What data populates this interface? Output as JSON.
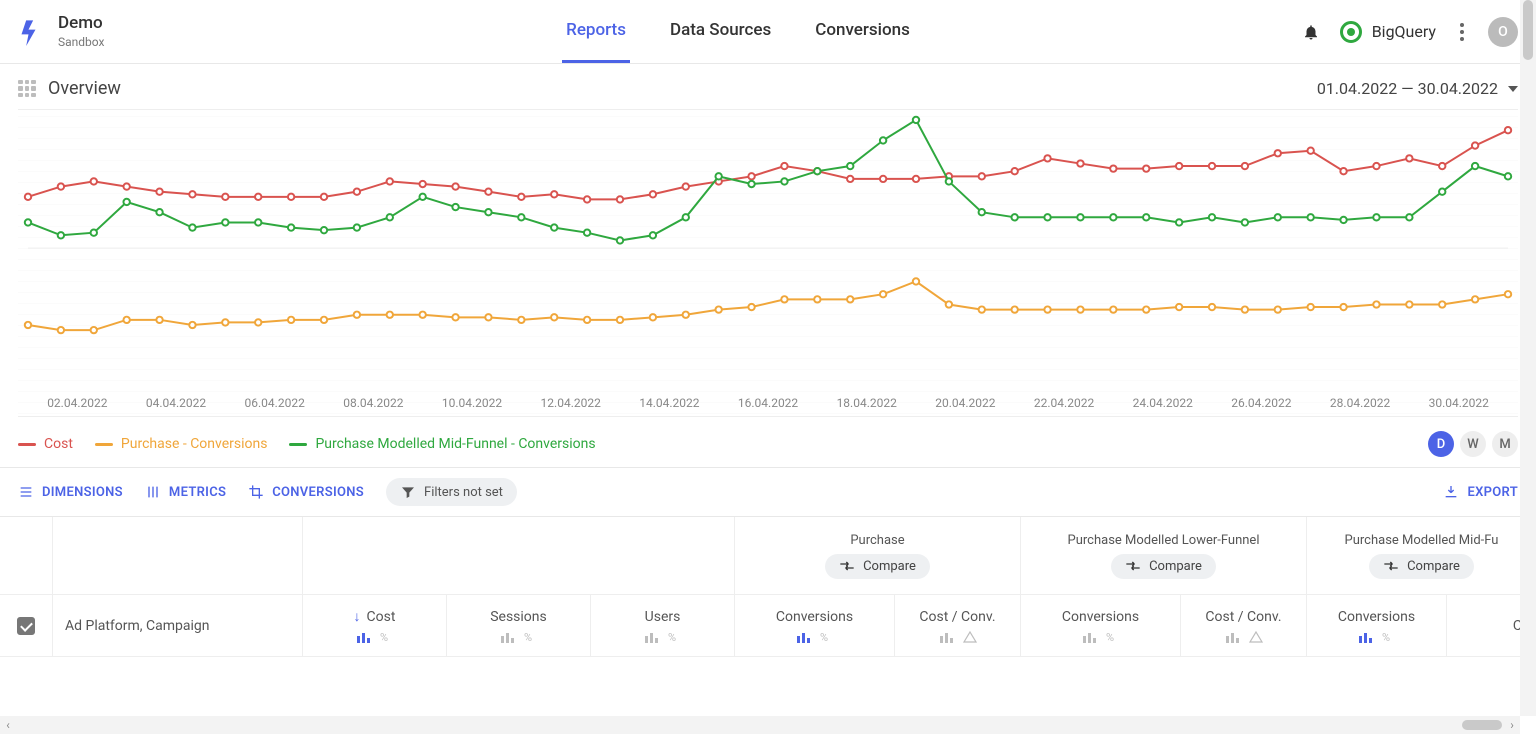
{
  "header": {
    "title": "Demo",
    "subtitle": "Sandbox",
    "nav": {
      "reports": "Reports",
      "data_sources": "Data Sources",
      "conversions": "Conversions",
      "active": "reports"
    },
    "db_label": "BigQuery",
    "avatar_initial": "O"
  },
  "subheader": {
    "page_title": "Overview",
    "date_range": "01.04.2022 — 30.04.2022"
  },
  "legend": {
    "items": [
      {
        "label": "Cost",
        "color": "#d9534f"
      },
      {
        "label": "Purchase - Conversions",
        "color": "#f0a63a"
      },
      {
        "label": "Purchase Modelled Mid-Funnel - Conversions",
        "color": "#2fa83f"
      }
    ],
    "granularity": {
      "options": [
        "D",
        "W",
        "M"
      ],
      "active": "D"
    }
  },
  "toolbar": {
    "dimensions": "DIMENSIONS",
    "metrics": "METRICS",
    "conversions": "CONVERSIONS",
    "filters": "Filters not set",
    "export": "EXPORT"
  },
  "table": {
    "groups": {
      "purchase": "Purchase",
      "lower_funnel": "Purchase Modelled Lower-Funnel",
      "mid_funnel": "Purchase Modelled Mid-Fu",
      "compare": "Compare"
    },
    "headers": {
      "dimension": "Ad Platform, Campaign",
      "cost": "Cost",
      "sessions": "Sessions",
      "users": "Users",
      "conversions": "Conversions",
      "cost_per_conv": "Cost / Conv.",
      "cost_short": "Co"
    }
  },
  "chart_data": {
    "type": "line",
    "x_labels": [
      "02.04.2022",
      "04.04.2022",
      "06.04.2022",
      "08.04.2022",
      "10.04.2022",
      "12.04.2022",
      "14.04.2022",
      "16.04.2022",
      "18.04.2022",
      "20.04.2022",
      "22.04.2022",
      "24.04.2022",
      "26.04.2022",
      "28.04.2022",
      "30.04.2022"
    ],
    "series": [
      {
        "name": "Cost",
        "color": "#d9534f",
        "values": [
          70,
          74,
          76,
          74,
          72,
          71,
          70,
          70,
          70,
          70,
          72,
          76,
          75,
          74,
          72,
          70,
          71,
          69,
          69,
          71,
          74,
          76,
          78,
          82,
          80,
          77,
          77,
          77,
          78,
          78,
          80,
          85,
          83,
          81,
          81,
          82,
          82,
          82,
          87,
          88,
          80,
          82,
          85,
          82,
          90,
          96
        ]
      },
      {
        "name": "Purchase - Conversions",
        "color": "#f0a63a",
        "values": [
          20,
          18,
          18,
          22,
          22,
          20,
          21,
          21,
          22,
          22,
          24,
          24,
          24,
          23,
          23,
          22,
          23,
          22,
          22,
          23,
          24,
          26,
          27,
          30,
          30,
          30,
          32,
          37,
          28,
          26,
          26,
          26,
          26,
          26,
          26,
          27,
          27,
          26,
          26,
          27,
          27,
          28,
          28,
          28,
          30,
          32
        ]
      },
      {
        "name": "Purchase Modelled Mid-Funnel - Conversions",
        "color": "#2fa83f",
        "values": [
          60,
          55,
          56,
          68,
          64,
          58,
          60,
          60,
          58,
          57,
          58,
          62,
          70,
          66,
          64,
          62,
          58,
          56,
          53,
          55,
          62,
          78,
          75,
          76,
          80,
          82,
          92,
          100,
          76,
          64,
          62,
          62,
          62,
          62,
          62,
          60,
          62,
          60,
          62,
          62,
          61,
          62,
          62,
          72,
          82,
          78
        ]
      }
    ],
    "y_min": 0,
    "y_max": 100,
    "x_domain": [
      "01.04.2022",
      "30.04.2022"
    ]
  }
}
